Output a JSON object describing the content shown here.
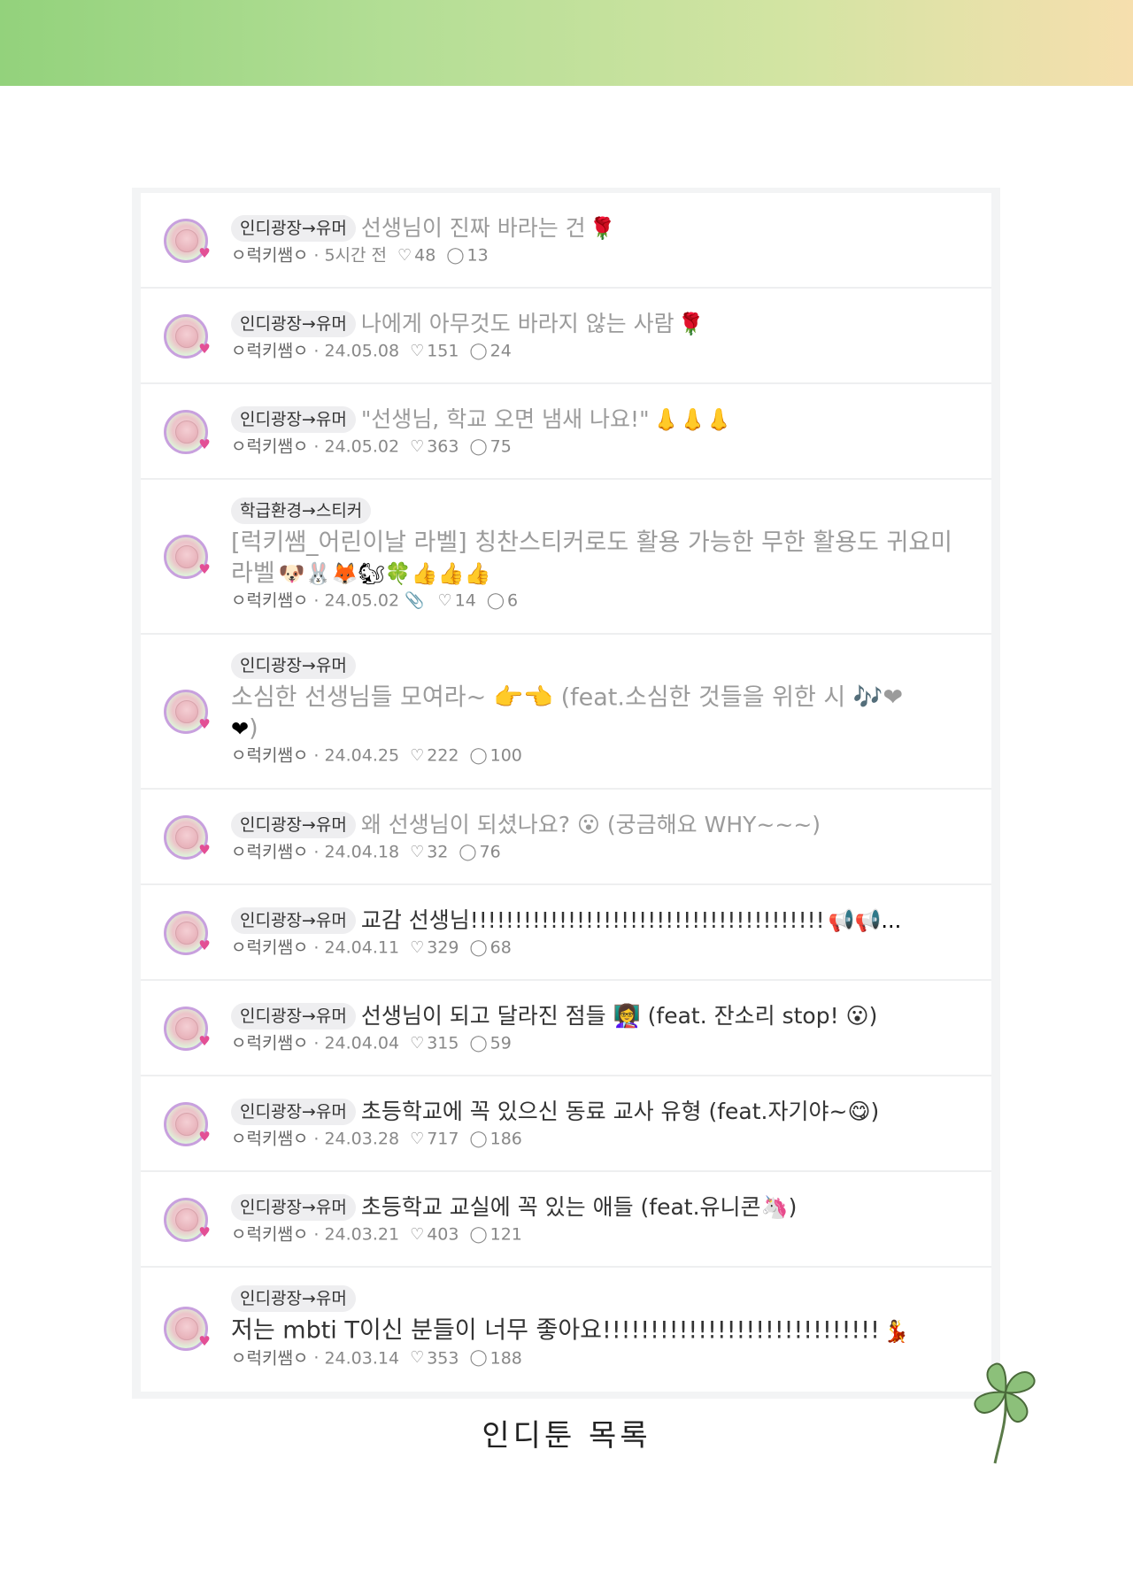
{
  "page": {
    "caption": "인디툰 목록",
    "colors": {
      "band_left": "#93d27c",
      "band_right": "#f6dfae",
      "heart": "#e34f95",
      "avatar_ring": "#c8a0de"
    }
  },
  "posts": [
    {
      "category": "인디광장→유머",
      "title": "선생님이 진짜 바라는 건",
      "title_style": "gray",
      "emoji": "🌹",
      "author": "ㅇ럭키쌤ㅇ",
      "date": "5시간 전",
      "likes": "48",
      "comments": "13"
    },
    {
      "category": "인디광장→유머",
      "title": "나에게 아무것도 바라지 않는 사람",
      "title_style": "gray",
      "emoji": "🌹",
      "author": "ㅇ럭키쌤ㅇ",
      "date": "24.05.08",
      "likes": "151",
      "comments": "24"
    },
    {
      "category": "인디광장→유머",
      "title": "\"선생님, 학교 오면 냄새 나요!\"",
      "title_style": "gray",
      "emoji": "👃👃👃",
      "author": "ㅇ럭키쌤ㅇ",
      "date": "24.05.02",
      "likes": "363",
      "comments": "75"
    },
    {
      "category": "학급환경→스티커",
      "title": "[럭키쌤_어린이날 라벨] 칭찬스티커로도 활용 가능한 무한 활용도 귀요미 라벨",
      "title_style": "gray",
      "emoji": "🐶🐰🦊🐿🍀👍👍👍",
      "author": "ㅇ럭키쌤ㅇ",
      "date": "24.05.02",
      "attachment_icon": "paperclip-icon",
      "likes": "14",
      "comments": "6"
    },
    {
      "category": "인디광장→유머",
      "title": "소심한 선생님들 모여라~ 👉👈 (feat.소심한 것들을 위한 시 🎶❤",
      "title_style": "gray",
      "emoji": "❤",
      "title_tail": ")",
      "author": "ㅇ럭키쌤ㅇ",
      "date": "24.04.25",
      "likes": "222",
      "comments": "100"
    },
    {
      "category": "인디광장→유머",
      "title": "왜 선생님이 되셨나요? 😮 (궁금해요 WHY~~~)",
      "title_style": "gray",
      "emoji": "",
      "author": "ㅇ럭키쌤ㅇ",
      "date": "24.04.18",
      "likes": "32",
      "comments": "76"
    },
    {
      "category": "인디광장→유머",
      "title": "교감 선생님!!!!!!!!!!!!!!!!!!!!!!!!!!!!!!!!!!!!!!!!",
      "title_style": "dark",
      "emoji": "📢📢...",
      "author": "ㅇ럭키쌤ㅇ",
      "date": "24.04.11",
      "likes": "329",
      "comments": "68"
    },
    {
      "category": "인디광장→유머",
      "title": "선생님이 되고 달라진 점들 👩‍🏫 (feat. 잔소리 stop! 😮)",
      "title_style": "dark",
      "emoji": "",
      "author": "ㅇ럭키쌤ㅇ",
      "date": "24.04.04",
      "likes": "315",
      "comments": "59"
    },
    {
      "category": "인디광장→유머",
      "title": "초등학교에 꼭 있으신 동료 교사 유형 (feat.자기야~😋)",
      "title_style": "dark",
      "emoji": "",
      "author": "ㅇ럭키쌤ㅇ",
      "date": "24.03.28",
      "likes": "717",
      "comments": "186"
    },
    {
      "category": "인디광장→유머",
      "title": "초등학교 교실에 꼭 있는 애들 (feat.유니콘🦄)",
      "title_style": "dark",
      "emoji": "",
      "author": "ㅇ럭키쌤ㅇ",
      "date": "24.03.21",
      "likes": "403",
      "comments": "121"
    },
    {
      "category": "인디광장→유머",
      "title": "저는 mbti T이신 분들이 너무 좋아요!!!!!!!!!!!!!!!!!!!!!!!!!!!!!",
      "title_style": "dark",
      "emoji": "💃",
      "author": "ㅇ럭키쌤ㅇ",
      "date": "24.03.14",
      "likes": "353",
      "comments": "188"
    }
  ]
}
